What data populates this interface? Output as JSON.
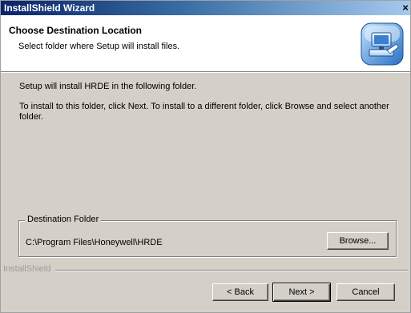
{
  "window": {
    "title": "InstallShield Wizard",
    "close_symbol": "×"
  },
  "header": {
    "title": "Choose Destination Location",
    "subtitle": "Select folder where Setup will install files.",
    "logo_icon": "computer-install-icon"
  },
  "body": {
    "line1": "Setup will install HRDE in the following folder.",
    "line2": "To install to this folder, click Next. To install to a different folder, click Browse and select another folder."
  },
  "destination": {
    "label": "Destination Folder",
    "path": "C:\\Program Files\\Honeywell\\HRDE",
    "browse_label": "Browse..."
  },
  "footer": {
    "brand": "InstallShield",
    "back_label": "< Back",
    "next_label": "Next >",
    "cancel_label": "Cancel"
  },
  "colors": {
    "title_gradient_start": "#0a246a",
    "title_gradient_end": "#a6caf0",
    "dialog_face": "#d4d0c8"
  }
}
